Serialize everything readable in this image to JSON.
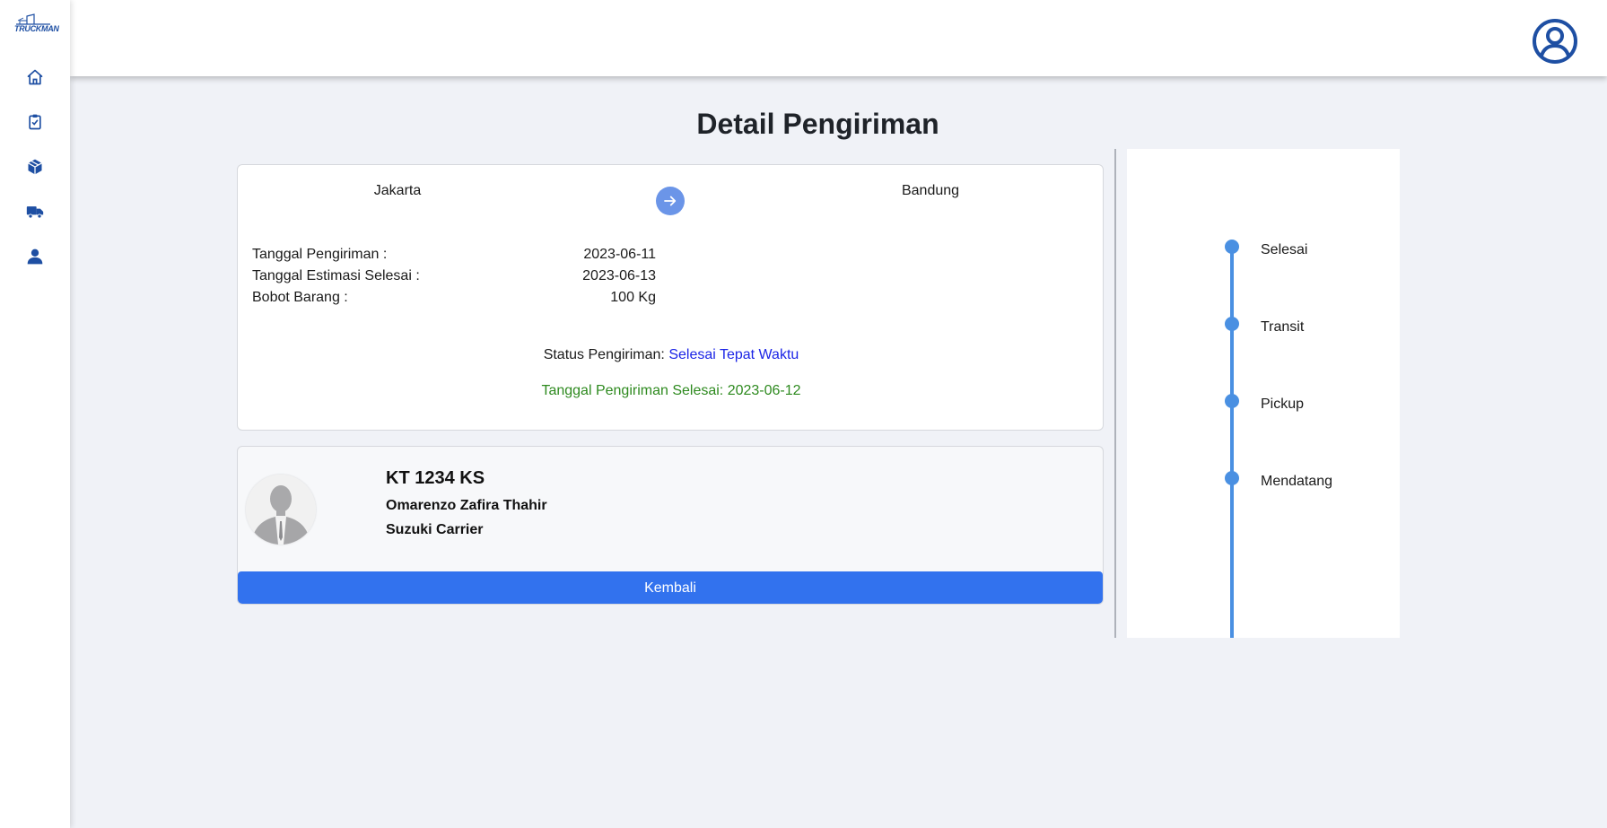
{
  "brand": {
    "name": "TRUCKMAN",
    "accent": "#1e4fa3"
  },
  "sidebar": {
    "items": [
      {
        "icon": "home-icon"
      },
      {
        "icon": "clipboard-check-icon"
      },
      {
        "icon": "package-icon"
      },
      {
        "icon": "truck-icon"
      },
      {
        "icon": "user-icon"
      }
    ]
  },
  "header": {
    "profile_icon": "user-circle-icon"
  },
  "page": {
    "title": "Detail Pengiriman"
  },
  "shipment": {
    "origin": "Jakarta",
    "destination": "Bandung",
    "rows": [
      {
        "label": "Tanggal Pengiriman :",
        "value": "2023-06-11"
      },
      {
        "label": "Tanggal Estimasi Selesai :",
        "value": "2023-06-13"
      },
      {
        "label": "Bobot Barang :",
        "value": "100 Kg"
      }
    ],
    "status_label": "Status Pengiriman:",
    "status_value": "Selesai Tepat Waktu",
    "finished_text": "Tanggal Pengiriman Selesai: 2023-06-12"
  },
  "driver": {
    "plate": "KT 1234 KS",
    "name": "Omarenzo Zafira Thahir",
    "vehicle": "Suzuki Carrier",
    "back_label": "Kembali"
  },
  "timeline": {
    "steps": [
      "Selesai",
      "Transit",
      "Pickup",
      "Mendatang"
    ],
    "color": "#4a90e2"
  },
  "colors": {
    "primary_button": "#3272ee",
    "status_link": "#1c25e6",
    "success_text": "#2e8a1f",
    "arrow_button": "#6b95e8"
  }
}
